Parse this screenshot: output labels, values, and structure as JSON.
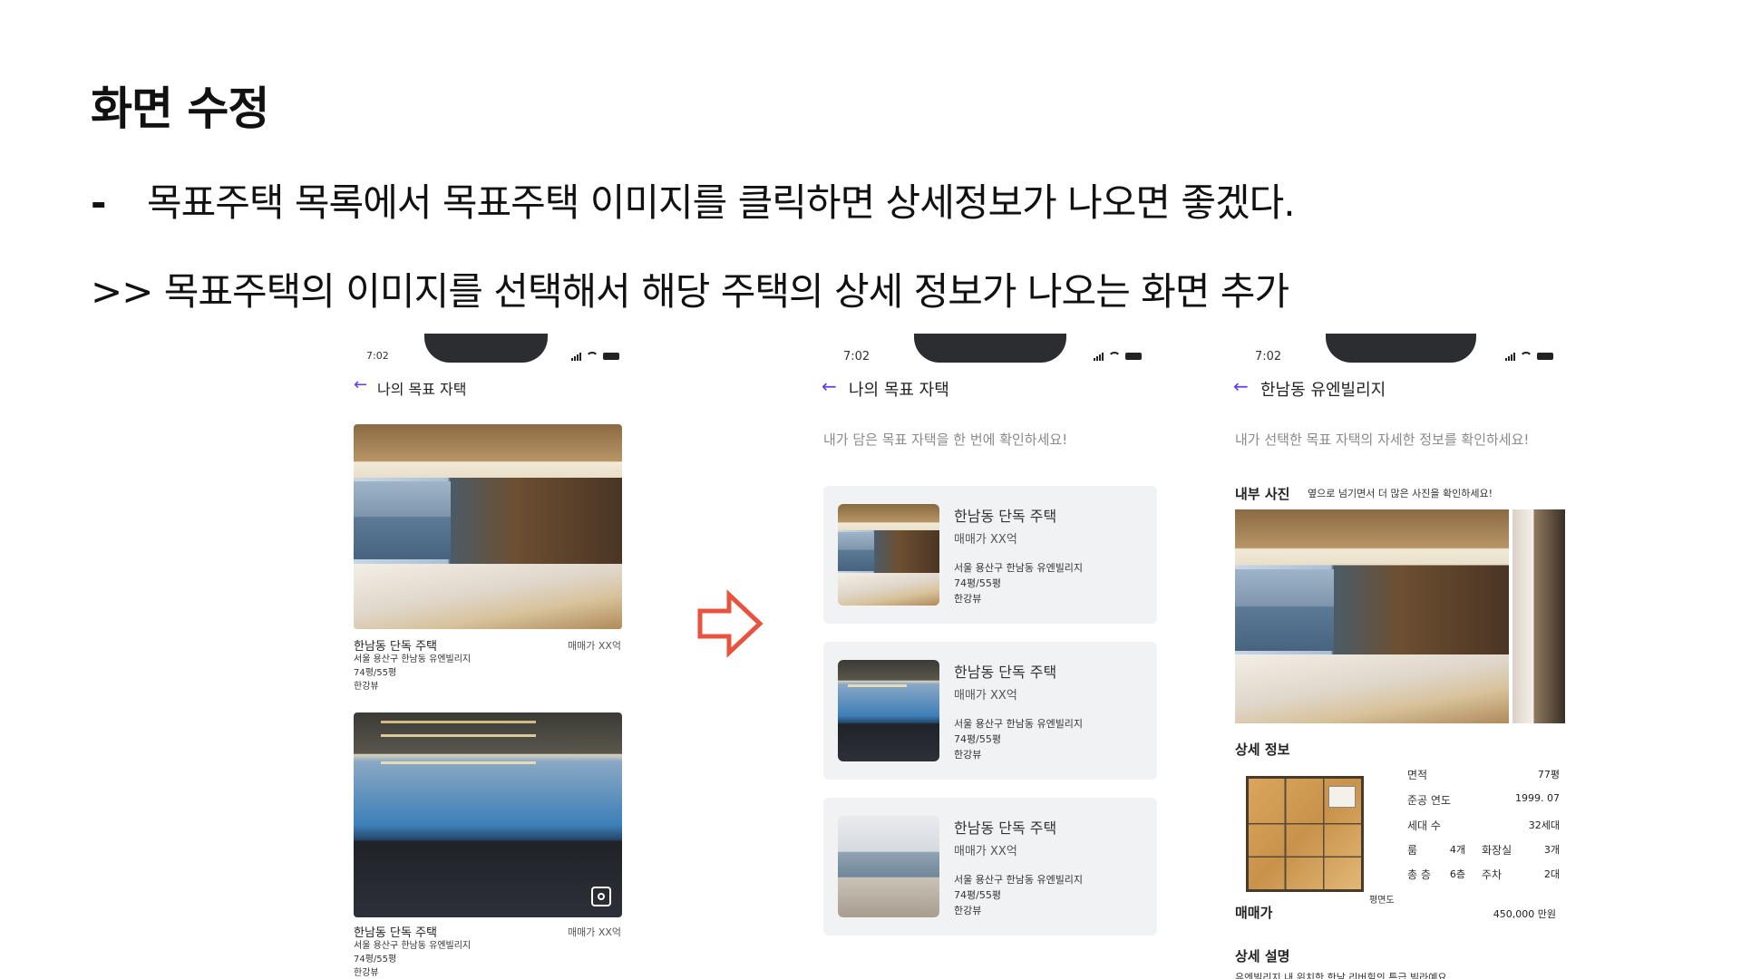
{
  "slide": {
    "title": "화면 수정",
    "bullet_dash": "-",
    "bullet_text": "목표주택 목록에서 목표주택 이미지를 클릭하면 상세정보가 나오면 좋겠다.",
    "result_text": ">> 목표주택의 이미지를 선택해서 해당 주택의 상세 정보가 나오는 화면 추가"
  },
  "screen_before": {
    "time": "7:02",
    "header": "나의 목표 자택",
    "items": [
      {
        "title": "한남동 단독 주택",
        "price": "매매가 XX억",
        "address": "서울 용산구 한남동 유엔빌리지",
        "size": "74평/55평",
        "view": "한강뷰"
      },
      {
        "title": "한남동 단독 주택",
        "price": "매매가 XX억",
        "address": "서울 용산구 한남동 유엔빌리지",
        "size": "74평/55평",
        "view": "한강뷰"
      }
    ]
  },
  "screen_list": {
    "time": "7:02",
    "header": "나의 목표 자택",
    "subtitle": "내가 담은 목표 자택을 한 번에 확인하세요!",
    "cards": [
      {
        "title": "한남동 단독 주택",
        "price": "매매가 XX억",
        "address": "서울 용산구 한남동 유엔빌리지",
        "size": "74평/55평",
        "view": "한강뷰"
      },
      {
        "title": "한남동 단독 주택",
        "price": "매매가 XX억",
        "address": "서울 용산구 한남동 유엔빌리지",
        "size": "74평/55평",
        "view": "한강뷰"
      },
      {
        "title": "한남동 단독 주택",
        "price": "매매가 XX억",
        "address": "서울 용산구 한남동 유엔빌리지",
        "size": "74평/55평",
        "view": "한강뷰"
      }
    ]
  },
  "screen_detail": {
    "time": "7:02",
    "header": "한남동 유엔빌리지",
    "subtitle": "내가 선택한 목표 자택의 자세한 정보를 확인하세요!",
    "photos_title": "내부 사진",
    "photos_hint": "옆으로 넘기면서 더 많은 사진을 확인하세요!",
    "info_title": "상세 정보",
    "plan_label": "평면도",
    "specs": {
      "area_label": "면적",
      "area_value": "77평",
      "year_label": "준공 연도",
      "year_value": "1999. 07",
      "households_label": "세대 수",
      "households_value": "32세대",
      "rooms_label": "룸",
      "rooms_value": "4개",
      "baths_label": "화장실",
      "baths_value": "3개",
      "floors_label": "총 층",
      "floors_value": "6층",
      "parking_label": "주차",
      "parking_value": "2대"
    },
    "sale_label": "매매가",
    "sale_value": "450,000 만원",
    "desc_title": "상세 설명",
    "desc_text": "유엔빌리지 내 위치한 한남 리버힐의 특급 빌라예요."
  },
  "colors": {
    "accent": "#5b3df5",
    "arrow": "#e8533f",
    "card_bg": "#f1f2f4"
  }
}
